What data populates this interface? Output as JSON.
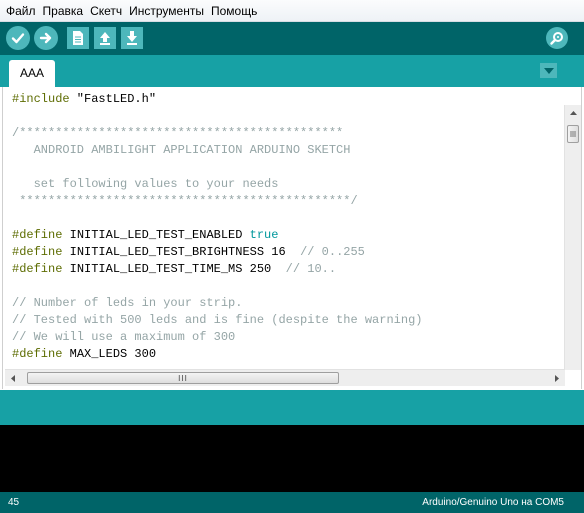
{
  "menu": {
    "items": [
      "Файл",
      "Правка",
      "Скетч",
      "Инструменты",
      "Помощь"
    ]
  },
  "toolbar": {
    "verify_icon": "checkmark-icon",
    "upload_icon": "arrow-right-icon",
    "new_icon": "new-file-icon",
    "open_icon": "open-arrow-up-icon",
    "save_icon": "save-arrow-down-icon",
    "serial_monitor_icon": "magnifier-icon"
  },
  "tabs": {
    "active_label": "AAA",
    "menu_icon": "triangle-down-icon"
  },
  "editor": {
    "lines": [
      [
        {
          "t": "#include",
          "c": "kw-pre"
        },
        {
          "t": " \"FastLED.h\"",
          "c": ""
        }
      ],
      [],
      [
        {
          "t": "/*********************************************",
          "c": "cm"
        }
      ],
      [
        {
          "t": "   ANDROID AMBILIGHT APPLICATION ARDUINO SKETCH",
          "c": "cm"
        }
      ],
      [],
      [
        {
          "t": "   set following values to your needs",
          "c": "cm"
        }
      ],
      [
        {
          "t": " **********************************************/",
          "c": "cm"
        }
      ],
      [],
      [
        {
          "t": "#define",
          "c": "kw-pre"
        },
        {
          "t": " INITIAL_LED_TEST_ENABLED ",
          "c": ""
        },
        {
          "t": "true",
          "c": "kw-lit"
        }
      ],
      [
        {
          "t": "#define",
          "c": "kw-pre"
        },
        {
          "t": " INITIAL_LED_TEST_BRIGHTNESS 16  ",
          "c": ""
        },
        {
          "t": "// 0..255",
          "c": "cm"
        }
      ],
      [
        {
          "t": "#define",
          "c": "kw-pre"
        },
        {
          "t": " INITIAL_LED_TEST_TIME_MS 250  ",
          "c": ""
        },
        {
          "t": "// 10..",
          "c": "cm"
        }
      ],
      [],
      [
        {
          "t": "// Number of leds in your strip.",
          "c": "cm"
        }
      ],
      [
        {
          "t": "// Tested with 500 leds and is fine (despite the warning)",
          "c": "cm"
        }
      ],
      [
        {
          "t": "// We will use a maximum of 300",
          "c": "cm"
        }
      ],
      [
        {
          "t": "#define",
          "c": "kw-pre"
        },
        {
          "t": " MAX_LEDS 300",
          "c": ""
        }
      ]
    ],
    "colors": {
      "preprocessor": "#5e6d03",
      "literal": "#00979c",
      "comment": "#95a5a6"
    },
    "hscroll_thumb_grip": "III"
  },
  "status": {
    "line_number": "45",
    "board_port": "Arduino/Genuino Uno на COM5"
  },
  "theme": {
    "dark_teal": "#006468",
    "mid_teal": "#17a1a5",
    "button_teal": "#4db7bb",
    "console_bg": "#000000"
  }
}
